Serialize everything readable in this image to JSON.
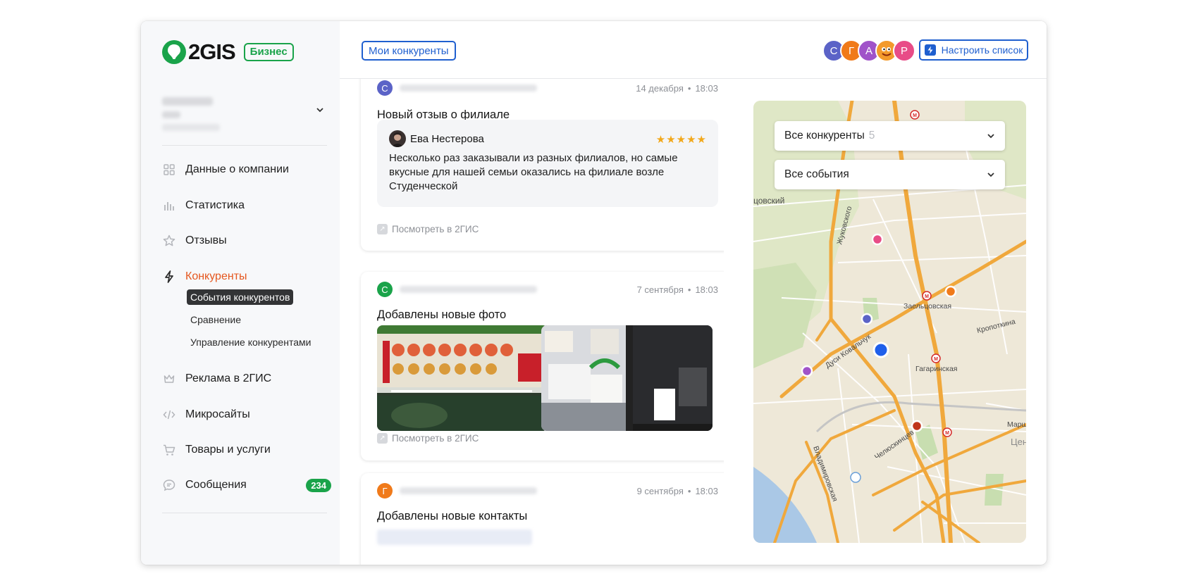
{
  "brand": {
    "logo_text": "2GIS",
    "badge": "Бизнес"
  },
  "sidebar": {
    "nav": [
      {
        "label": "Данные о компании",
        "icon": "grid-icon"
      },
      {
        "label": "Статистика",
        "icon": "bar-chart-icon"
      },
      {
        "label": "Отзывы",
        "icon": "star-icon"
      },
      {
        "label": "Конкуренты",
        "icon": "lightning-icon",
        "active": true
      },
      {
        "label": "Реклама в 2ГИС",
        "icon": "crown-icon"
      },
      {
        "label": "Микросайты",
        "icon": "code-icon"
      },
      {
        "label": "Товары и услуги",
        "icon": "cart-icon"
      },
      {
        "label": "Сообщения",
        "icon": "chat-icon",
        "badge": "234"
      }
    ],
    "sub_nav": [
      {
        "label": "События конкурентов",
        "selected": true
      },
      {
        "label": "Сравнение"
      },
      {
        "label": "Управление конкурентами"
      }
    ]
  },
  "header": {
    "tab": "Мои конкуренты",
    "avatars": [
      {
        "letter": "С",
        "color": "#5b63c7"
      },
      {
        "letter": "Г",
        "color": "#f07a1a"
      },
      {
        "letter": "А",
        "color": "#a053c9"
      },
      {
        "letter": "",
        "color": "#f39a2c"
      },
      {
        "letter": "Р",
        "color": "#e84c87"
      }
    ],
    "setup_button": "Настроить список"
  },
  "feed": [
    {
      "avatar": "С",
      "avatar_color": "#5b63c7",
      "date": "14 декабря",
      "time": "18:03",
      "title": "Новый отзыв о филиале",
      "review": {
        "author": "Ева Нестерова",
        "stars": "★★★★★",
        "text": "Несколько раз заказывали из разных филиалов, но самые вкусные для нашей семьи оказались на филиале возле Студенческой"
      },
      "link": "Посмотреть в 2ГИС"
    },
    {
      "avatar": "С",
      "avatar_color": "#1aa34a",
      "date": "7 сентября",
      "time": "18:03",
      "title": "Добавлены новые фото",
      "link": "Посмотреть в 2ГИС"
    },
    {
      "avatar": "Г",
      "avatar_color": "#f07a1a",
      "date": "9 сентября",
      "time": "18:03",
      "title": "Добавлены новые контакты"
    }
  ],
  "map": {
    "filter_competitors": "Все конкуренты",
    "filter_competitors_count": "5",
    "filter_events": "Все события",
    "labels": {
      "zhukovskogo": "Жуковского",
      "zaeltsovskaya": "Заельцовская",
      "kropotkina": "Кропоткина",
      "dusi": "Дуси Ковальчук",
      "gagarinskaya": "Гагаринская",
      "chelyuskintsev": "Челюскинцев",
      "vladimirovskaya": "Владимировская",
      "edge1": "цовский",
      "edge2": "Марш",
      "edge3": "Цен"
    }
  }
}
